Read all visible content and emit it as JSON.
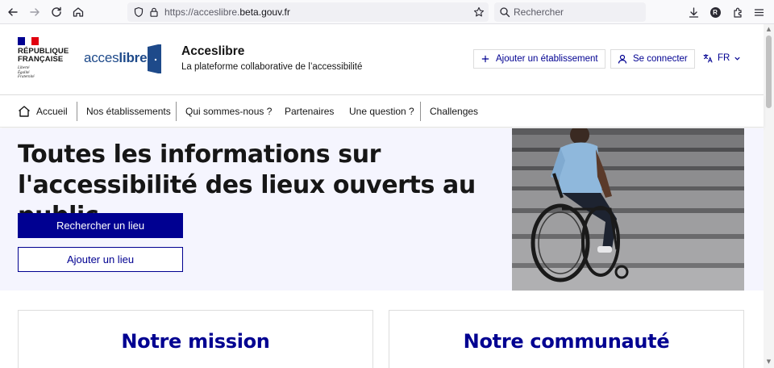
{
  "browser": {
    "url_prefix": "https://acceslibre.",
    "url_domain": "beta.gouv.fr",
    "search_placeholder": "Rechercher",
    "profile_initial": "R",
    "icons": [
      "back-arrow-icon",
      "forward-arrow-icon",
      "reload-icon",
      "home-icon",
      "shield-icon",
      "lock-icon",
      "star-icon",
      "search-icon",
      "download-icon",
      "extensions-icon",
      "menu-icon"
    ]
  },
  "header": {
    "republique_line1": "RÉPUBLIQUE",
    "republique_line2": "FRANÇAISE",
    "devise": [
      "Liberté",
      "Égalité",
      "Fraternité"
    ],
    "logo_part1": "acces",
    "logo_part2": "libre",
    "site_name": "Acceslibre",
    "tagline": "La plateforme collaborative de l’accessibilité",
    "add_establishment": "Ajouter un établissement",
    "login": "Se connecter",
    "language": "FR"
  },
  "nav": {
    "home": "Accueil",
    "establishments": "Nos établissements",
    "about": "Qui sommes-nous ?",
    "partners": "Partenaires",
    "question": "Une question ?",
    "challenges": "Challenges"
  },
  "hero": {
    "title": "Toutes les informations sur l'accessibilité des lieux ouverts au public",
    "search_button": "Rechercher un lieu",
    "add_button": "Ajouter un lieu"
  },
  "cards": {
    "mission": "Notre mission",
    "community": "Notre communauté"
  },
  "colors": {
    "primary_blue": "#000091",
    "hero_background": "#f5f5fe",
    "flag_blue": "#000091",
    "flag_red": "#e1000f"
  }
}
